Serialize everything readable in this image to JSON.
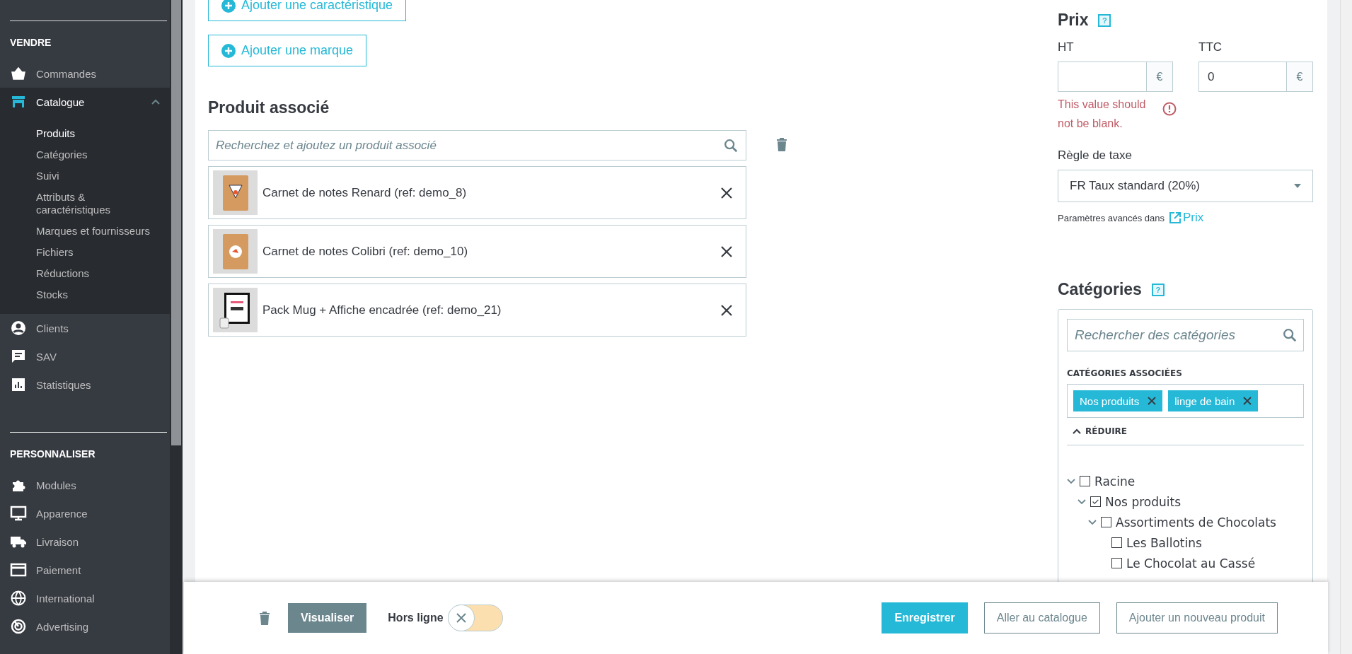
{
  "sidebar": {
    "sections": [
      {
        "title": "VENDRE",
        "items": [
          {
            "label": "Commandes",
            "selected": false
          },
          {
            "label": "Catalogue",
            "selected": true,
            "expanded": true,
            "children": [
              {
                "label": "Produits",
                "selected": true
              },
              {
                "label": "Catégories",
                "selected": false
              },
              {
                "label": "Suivi",
                "selected": false
              },
              {
                "label": "Attributs & caractéristiques",
                "selected": false
              },
              {
                "label": "Marques et fournisseurs",
                "selected": false
              },
              {
                "label": "Fichiers",
                "selected": false
              },
              {
                "label": "Réductions",
                "selected": false
              },
              {
                "label": "Stocks",
                "selected": false
              }
            ]
          },
          {
            "label": "Clients",
            "selected": false
          },
          {
            "label": "SAV",
            "selected": false
          },
          {
            "label": "Statistiques",
            "selected": false
          }
        ]
      },
      {
        "title": "PERSONNALISER",
        "items": [
          {
            "label": "Modules",
            "selected": false
          },
          {
            "label": "Apparence",
            "selected": false
          },
          {
            "label": "Livraison",
            "selected": false
          },
          {
            "label": "Paiement",
            "selected": false
          },
          {
            "label": "International",
            "selected": false
          },
          {
            "label": "Advertising",
            "selected": false
          }
        ]
      }
    ]
  },
  "main": {
    "add_buttons": [
      "Ajouter une caractéristique",
      "Ajouter une marque"
    ],
    "related": {
      "title": "Produit associé",
      "search": {
        "placeholder": "Recherchez et ajoutez un produit associé"
      },
      "products": [
        {
          "name": "Carnet de notes Renard (ref: demo_8)"
        },
        {
          "name": "Carnet de notes Colibri (ref: demo_10)"
        },
        {
          "name": "Pack Mug + Affiche encadrée (ref: demo_21)"
        }
      ]
    }
  },
  "price": {
    "title": "Prix",
    "help": "?",
    "fields": [
      {
        "label": "HT",
        "currency": "€",
        "error": "This value should not be blank."
      },
      {
        "label": "TTC",
        "value": "0",
        "currency": "€"
      }
    ],
    "tax": {
      "label": "Règle de taxe",
      "value": "FR Taux standard (20%)"
    },
    "advanced": {
      "text": "Paramètres avancés dans",
      "link": "Prix"
    }
  },
  "categories": {
    "title": "Catégories",
    "help": "?",
    "search": {
      "placeholder": "Rechercher des catégories"
    },
    "associated_title": "CATÉGORIES ASSOCIÉES",
    "tags": [
      "Nos produits",
      "linge de bain"
    ],
    "collapse": "RÉDUIRE",
    "tree": [
      {
        "label": "Racine",
        "checked": false,
        "expanded": true,
        "children": [
          {
            "label": "Nos produits",
            "checked": true,
            "expanded": true,
            "children": [
              {
                "label": "Assortiments de Chocolats",
                "checked": false,
                "expanded": true,
                "children": [
                  {
                    "label": "Les Ballotins",
                    "checked": false
                  },
                  {
                    "label": "Le Chocolat au Cassé",
                    "checked": false
                  }
                ]
              }
            ]
          }
        ]
      }
    ]
  },
  "footer": {
    "preview": "Visualiser",
    "status": {
      "label": "Hors ligne",
      "on": false
    },
    "buttons": [
      "Enregistrer",
      "Aller au catalogue",
      "Ajouter un nouveau produit"
    ]
  }
}
